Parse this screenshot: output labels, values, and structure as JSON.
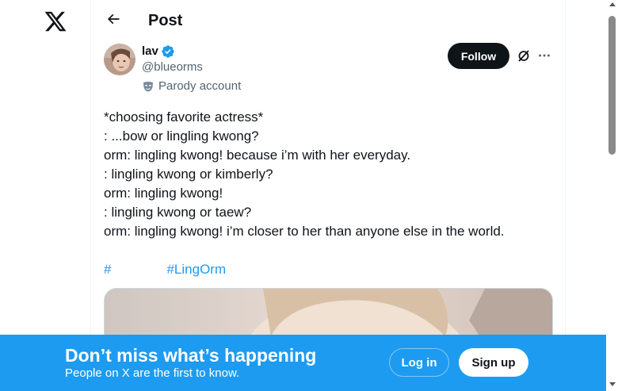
{
  "header": {
    "title": "Post"
  },
  "author": {
    "name": "lav",
    "handle": "@blueorms",
    "label": "Parody account"
  },
  "actions": {
    "follow_label": "Follow"
  },
  "post": {
    "lines": [
      "*choosing favorite actress*",
      ": ...bow or lingling kwong?",
      "orm: lingling kwong! because i’m with her everyday.",
      ": lingling kwong or kimberly?",
      "orm: lingling kwong!",
      ": lingling kwong or taew?",
      "orm: lingling kwong! i’m closer to her than anyone else in the world."
    ],
    "hashtags": [
      "#",
      "#LingOrm"
    ]
  },
  "banner": {
    "headline": "Don’t miss what’s happening",
    "subtext": "People on X are the first to know.",
    "login_label": "Log in",
    "signup_label": "Sign up"
  },
  "icons": {
    "logo": "x-logo-icon",
    "back": "arrow-left-icon",
    "verified": "verified-badge-icon",
    "parody": "parody-mask-icon",
    "grok": "grok-icon",
    "more": "more-dots-icon"
  },
  "colors": {
    "accent": "#1d9bf0",
    "text": "#0f1419",
    "secondary_text": "#536471",
    "follow_bg": "#0f1419"
  }
}
